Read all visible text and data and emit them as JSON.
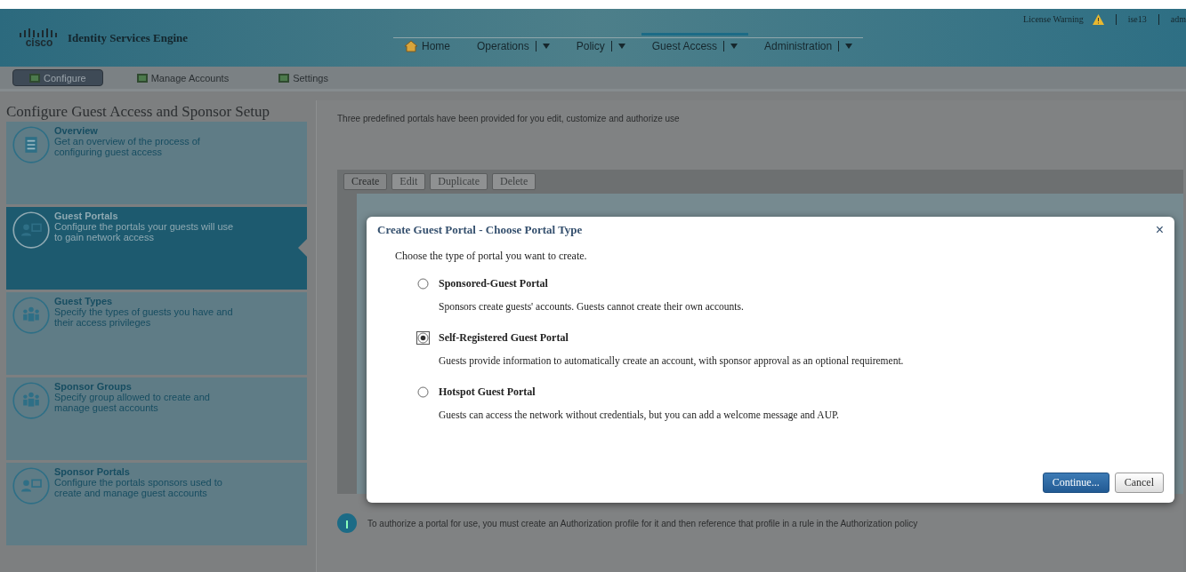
{
  "header": {
    "product": "Identity Services Engine",
    "logo_text": "cisco",
    "links": [
      {
        "label": "License Warning"
      },
      {
        "label": "ise13"
      },
      {
        "label": "adm"
      }
    ],
    "nav": [
      {
        "label": "Home",
        "kind": "home",
        "selected": false
      },
      {
        "label": "Operations",
        "kind": "menu",
        "selected": false
      },
      {
        "label": "Policy",
        "kind": "menu",
        "selected": false
      },
      {
        "label": "Guest Access",
        "kind": "menu",
        "selected": true
      },
      {
        "label": "Administration",
        "kind": "menu",
        "selected": false
      }
    ]
  },
  "subnav": [
    {
      "label": "Configure",
      "selected": true
    },
    {
      "label": "Manage Accounts",
      "selected": false
    },
    {
      "label": "Settings",
      "selected": false
    }
  ],
  "page_title": "Configure Guest Access and Sponsor Setup",
  "sidebar": {
    "items": [
      {
        "title": "Overview",
        "description": "Get an overview of the process of configuring guest access",
        "kind": "overview",
        "selected": false
      },
      {
        "title": "Guest Portals",
        "description": "Configure the portals your guests will use to gain network access",
        "kind": "portal",
        "selected": true
      },
      {
        "title": "Guest Types",
        "description": "Specify the types of guests you have and their access privileges",
        "kind": "group",
        "selected": false
      },
      {
        "title": "Sponsor Groups",
        "description": "Specify group allowed to create and manage guest accounts",
        "kind": "group",
        "selected": false
      },
      {
        "title": "Sponsor Portals",
        "description": "Configure the portals sponsors used to create and manage guest accounts",
        "kind": "portal",
        "selected": false
      }
    ]
  },
  "content": {
    "intro": "Three predefined portals have been provided for you edit, customize and authorize use",
    "toolbar": [
      {
        "label": "Create",
        "disabled": false
      },
      {
        "label": "Edit",
        "disabled": true
      },
      {
        "label": "Duplicate",
        "disabled": true
      },
      {
        "label": "Delete",
        "disabled": true
      }
    ],
    "info": "To authorize a portal for use, you must create an Authorization profile for it and then reference that profile in a rule in the Authorization policy"
  },
  "dialog": {
    "title": "Create Guest Portal - Choose Portal Type",
    "close": "×",
    "prompt": "Choose the type of portal you want to create.",
    "options": [
      {
        "label": "Sponsored-Guest Portal",
        "description": "Sponsors create guests' accounts. Guests cannot create their own accounts.",
        "selected": false
      },
      {
        "label": "Self-Registered Guest Portal",
        "description": "Guests provide information to automatically create an account, with sponsor approval as an optional requirement.",
        "selected": true
      },
      {
        "label": "Hotspot Guest Portal",
        "description": "Guests can access the network without credentials, but you can add a welcome message and AUP.",
        "selected": false
      }
    ],
    "buttons": [
      {
        "label": "Continue...",
        "kind": "primary"
      },
      {
        "label": "Cancel",
        "kind": "secondary"
      }
    ]
  }
}
